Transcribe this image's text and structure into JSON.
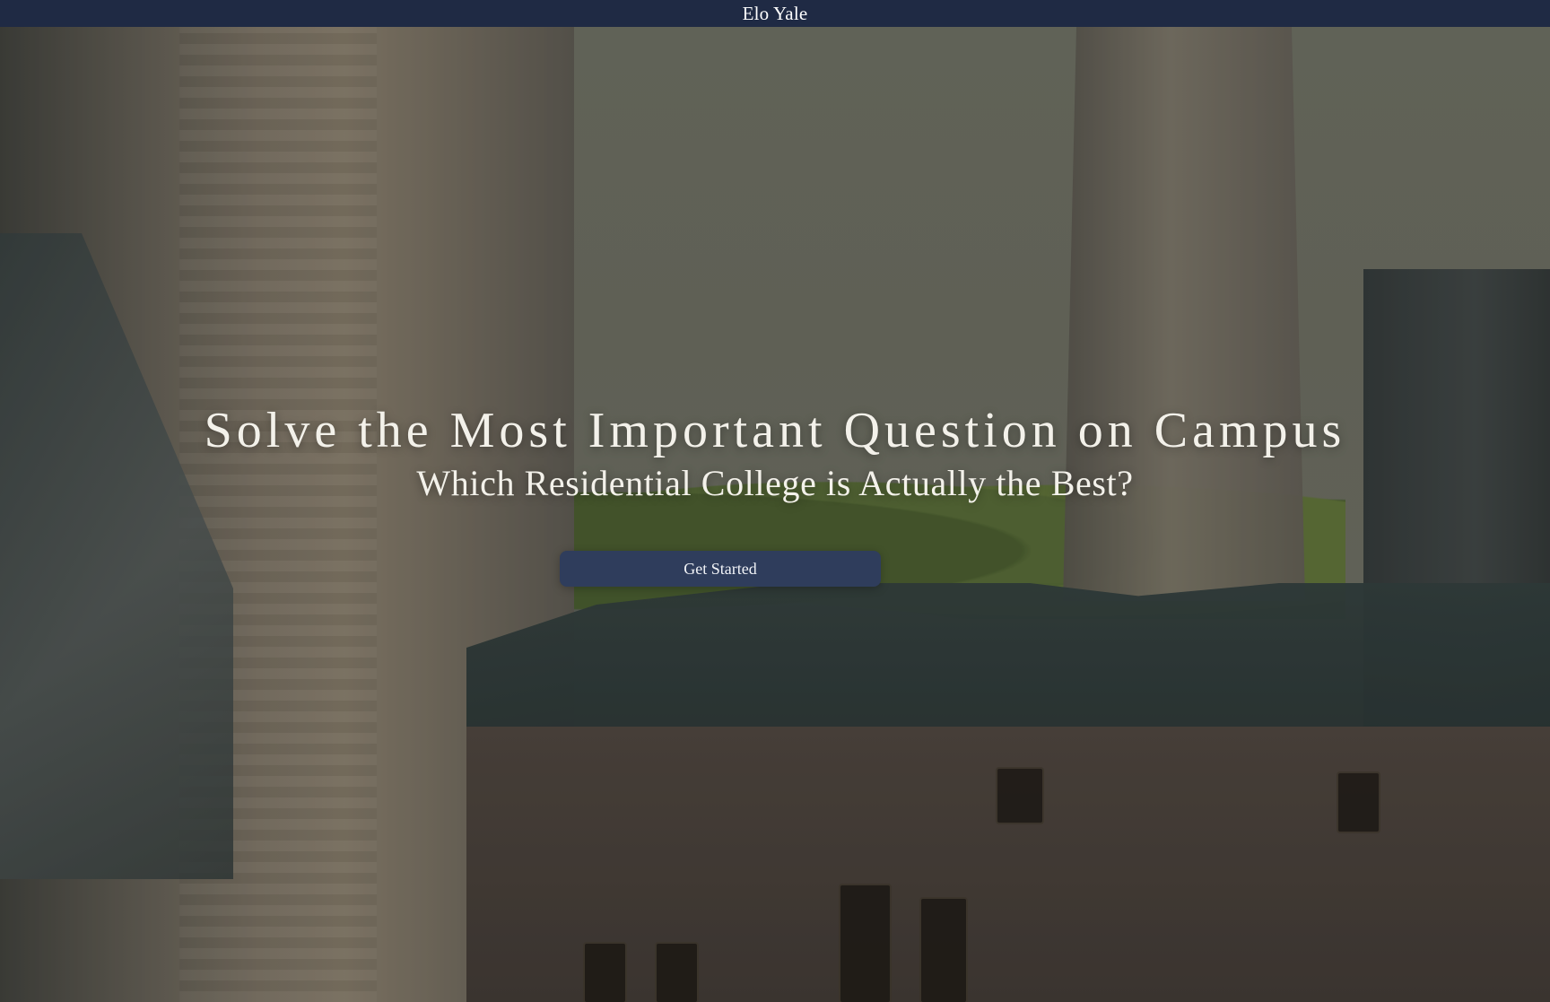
{
  "header": {
    "brand": "Elo Yale"
  },
  "hero": {
    "title": "Solve the Most Important Question on Campus",
    "subtitle": "Which Residential College is Actually the Best?",
    "cta_label": "Get Started"
  },
  "colors": {
    "topbar_bg": "#1f2a44",
    "cta_bg": "#2f3d5c",
    "text_light": "#f3f1ea"
  }
}
